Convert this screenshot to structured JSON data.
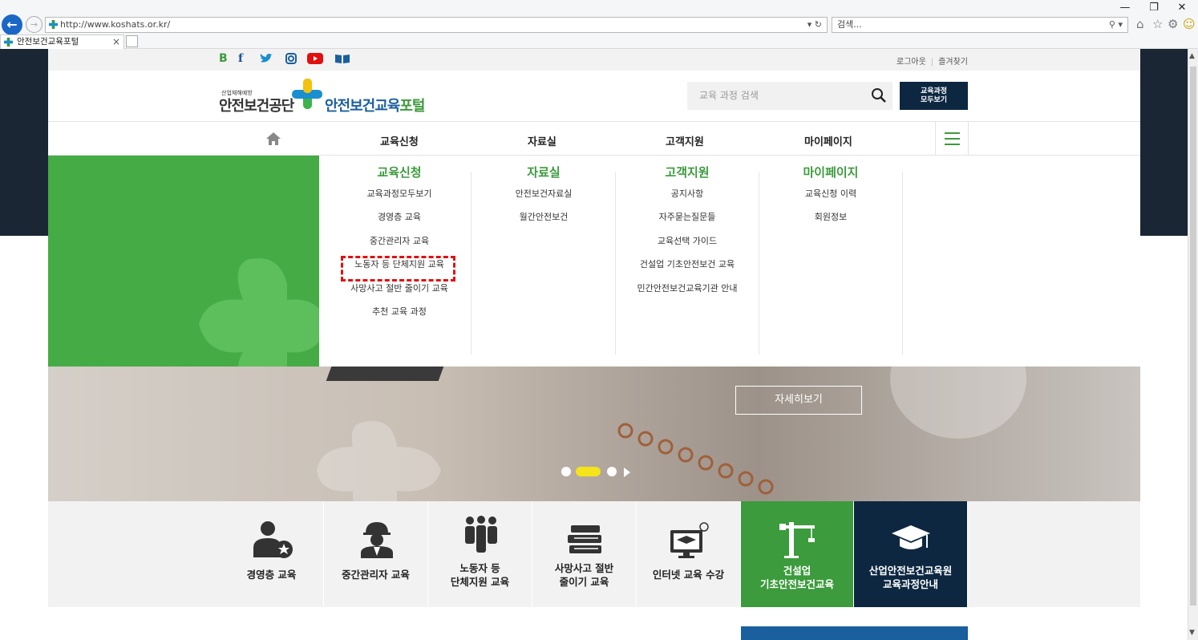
{
  "window": {
    "minimize": "—",
    "restore": "❐",
    "close": "✕"
  },
  "browser": {
    "url": "http://www.koshats.or.kr/",
    "url_controls": "▾ ↻",
    "search_placeholder": "검색...",
    "search_controls": "⚲ ▾",
    "tab_title": "안전보건교육포털",
    "tab_close": "×",
    "toolbar_icons": [
      "home-icon",
      "star-icon",
      "gear-icon",
      "smiley-icon"
    ]
  },
  "topbar": {
    "sns": [
      "blog-icon",
      "facebook-icon",
      "twitter-icon",
      "instagram-icon",
      "youtube-icon",
      "book-icon"
    ],
    "logout": "로그아웃",
    "sep": "|",
    "favorites": "즐겨찾기"
  },
  "header": {
    "logo_small": "산업재해예방",
    "logo_kosha": "안전보건공단",
    "logo_portal_a": "안전보건교육",
    "logo_portal_b": "포털",
    "search_placeholder": "교육 과정 검색",
    "all_courses_line1": "교육과정",
    "all_courses_line2": "모두보기"
  },
  "nav": {
    "items": [
      "교육신청",
      "자료실",
      "고객지원",
      "마이페이지"
    ]
  },
  "mega": {
    "columns": [
      {
        "title": "교육신청",
        "items": [
          "교육과정모두보기",
          "경영층 교육",
          "중간관리자 교육",
          "노동자 등 단체지원 교육",
          "사망사고 절반 줄이기 교육",
          "추천 교육 과정"
        ]
      },
      {
        "title": "자료실",
        "items": [
          "안전보건자료실",
          "월간안전보건"
        ]
      },
      {
        "title": "고객지원",
        "items": [
          "공지사항",
          "자주묻는질문들",
          "교육선택 가이드",
          "건설업 기초안전보건 교육",
          "민간안전보건교육기관 안내"
        ]
      },
      {
        "title": "마이페이지",
        "items": [
          "교육신청 이력",
          "회원정보"
        ]
      }
    ]
  },
  "hero": {
    "detail_button": "자세히보기",
    "slides_total": 3,
    "slide_active": 2
  },
  "quick": {
    "items": [
      {
        "line1": "경영층 교육",
        "line2": ""
      },
      {
        "line1": "중간관리자 교육",
        "line2": ""
      },
      {
        "line1": "노동자 등",
        "line2": "단체지원 교육"
      },
      {
        "line1": "사망사고 절반",
        "line2": "줄이기 교육"
      },
      {
        "line1": "인터넷 교육 수강",
        "line2": ""
      },
      {
        "line1": "건설업",
        "line2": "기초안전보건교육"
      },
      {
        "line1": "산업안전보건교육원",
        "line2": "교육과정안내"
      }
    ]
  },
  "colors": {
    "green": "#3c9b3c",
    "navy": "#0d2741",
    "highlight": "#e01010",
    "slider_active": "#f4e419"
  }
}
